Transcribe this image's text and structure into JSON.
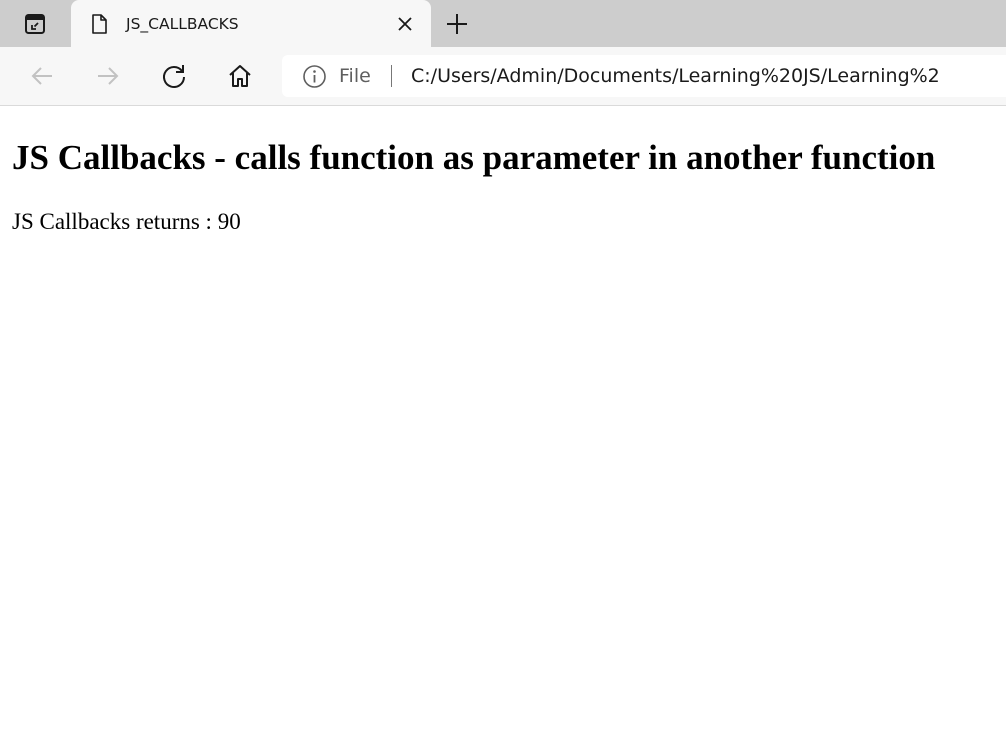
{
  "browser": {
    "tab": {
      "title": "JS_CALLBACKS"
    },
    "address_bar": {
      "security_label": "File",
      "url": "C:/Users/Admin/Documents/Learning%20JS/Learning%2"
    }
  },
  "page": {
    "heading": "JS Callbacks - calls function as parameter in another function",
    "result_label": "JS Callbacks returns : 90"
  }
}
